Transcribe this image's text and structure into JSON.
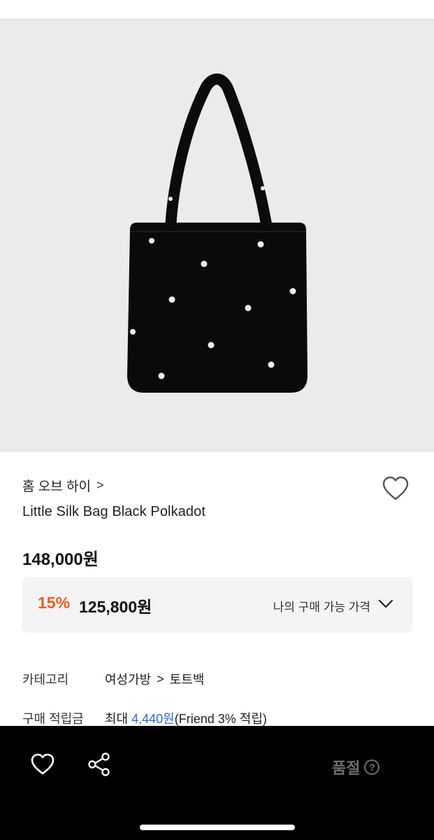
{
  "product": {
    "brand": "홈 오브 하이",
    "brand_chevron": ">",
    "name": "Little Silk Bag Black Polkadot",
    "price": "148,000원",
    "image_icon": "polka-dot-tote-bag"
  },
  "discount": {
    "rate": "15%",
    "price": "125,800원",
    "label": "나의 구매 가능 가격",
    "rate_color": "#ef5a27"
  },
  "info": {
    "category_key": "카테고리",
    "category_parent": "여성가방",
    "category_sep": ">",
    "category_child": "토트백",
    "points_key": "구매 적립금",
    "points_prefix": "최대 ",
    "points_amount": "4,440원",
    "points_suffix": "(Friend 3% 적립)",
    "points_color": "#2d68d8"
  },
  "bottom_bar": {
    "status_label": "품절",
    "help_glyph": "?"
  }
}
